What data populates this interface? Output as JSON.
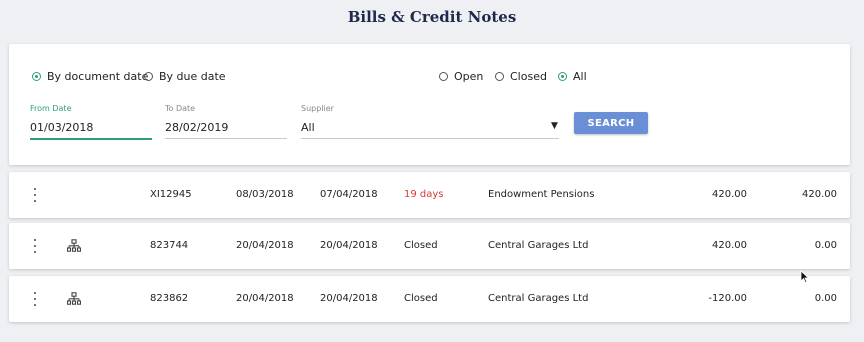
{
  "page": {
    "title": "Bills & Credit Notes"
  },
  "filters": {
    "date_mode": [
      {
        "label": "By document date",
        "selected": true
      },
      {
        "label": "By due date",
        "selected": false
      }
    ],
    "status": [
      {
        "label": "Open",
        "selected": false
      },
      {
        "label": "Closed",
        "selected": false
      },
      {
        "label": "All",
        "selected": true
      }
    ],
    "from_date": {
      "label": "From Date",
      "value": "01/03/2018"
    },
    "to_date": {
      "label": "To Date",
      "value": "28/02/2019"
    },
    "supplier": {
      "label": "Supplier",
      "value": "All"
    },
    "search_label": "SEARCH"
  },
  "rows": [
    {
      "ref": "XI12945",
      "doc_date": "08/03/2018",
      "due_date": "07/04/2018",
      "status": "19 days",
      "status_overdue": true,
      "supplier": "Endowment Pensions",
      "amount": "420.00",
      "outstanding": "420.00",
      "has_tree_icon": false
    },
    {
      "ref": "823744",
      "doc_date": "20/04/2018",
      "due_date": "20/04/2018",
      "status": "Closed",
      "status_overdue": false,
      "supplier": "Central Garages Ltd",
      "amount": "420.00",
      "outstanding": "0.00",
      "has_tree_icon": true
    },
    {
      "ref": "823862",
      "doc_date": "20/04/2018",
      "due_date": "20/04/2018",
      "status": "Closed",
      "status_overdue": false,
      "supplier": "Central Garages Ltd",
      "amount": "-120.00",
      "outstanding": "0.00",
      "has_tree_icon": true
    }
  ],
  "icons": {
    "row_menu": "kebab-menu-icon",
    "hierarchy": "hierarchy-icon",
    "dropdown": "dropdown-caret-icon"
  },
  "colors": {
    "accent": "#2e9e7a",
    "button": "#6b8fd6",
    "overdue": "#d23b3b",
    "title": "#1f2a48"
  }
}
